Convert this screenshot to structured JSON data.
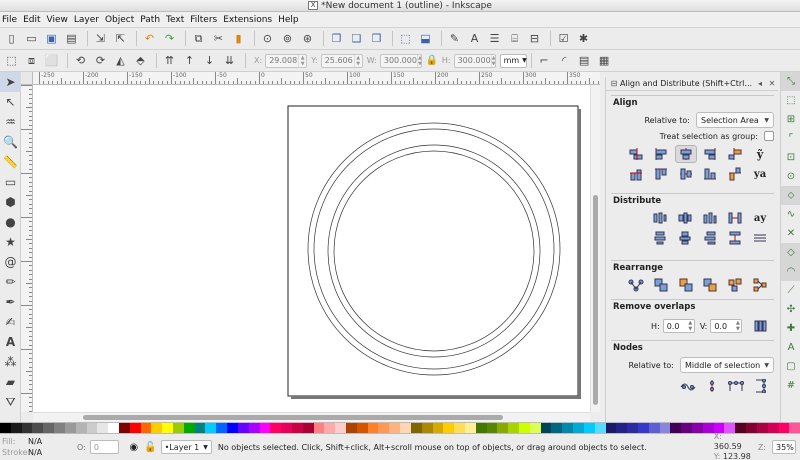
{
  "window": {
    "title": "*New document 1 (outline) - Inkscape"
  },
  "menu": [
    "File",
    "Edit",
    "View",
    "Layer",
    "Object",
    "Path",
    "Text",
    "Filters",
    "Extensions",
    "Help"
  ],
  "controls": {
    "x_label": "X:",
    "x_value": "29.008",
    "y_label": "Y:",
    "y_value": "25.606",
    "w_label": "W:",
    "w_value": "300.000",
    "h_label": "H:",
    "h_value": "300.000",
    "unit": "mm"
  },
  "ruler": {
    "labels": [
      "-250",
      "-200",
      "-150",
      "-100",
      "-50",
      "0",
      "50",
      "100",
      "150",
      "200",
      "250",
      "300",
      "350",
      "400"
    ]
  },
  "align_panel": {
    "title": "Align and Distribute (Shift+Ctrl...",
    "align": {
      "heading": "Align",
      "relative_to_label": "Relative to:",
      "relative_to_value": "Selection Area",
      "group_label": "Treat selection as group:"
    },
    "distribute_heading": "Distribute",
    "rearrange_heading": "Rearrange",
    "remove_overlaps": {
      "heading": "Remove overlaps",
      "h_label": "H:",
      "h_value": "0.0",
      "v_label": "V:",
      "v_value": "0.0"
    },
    "nodes": {
      "heading": "Nodes",
      "relative_to_label": "Relative to:",
      "relative_to_value": "Middle of selection"
    }
  },
  "status": {
    "fill_label": "Fill:",
    "fill_value": "N/A",
    "stroke_label": "Stroke:",
    "stroke_value": "N/A",
    "opacity_label": "O:",
    "opacity_value": "0",
    "layer": "•Layer 1",
    "message": "No objects selected. Click, Shift+click, Alt+scroll mouse on top of objects, or drag around objects to select.",
    "x_label": "X:",
    "x_value": "360.59",
    "y_label": "Y:",
    "y_value": "123.98",
    "z_label": "Z:",
    "zoom": "35%"
  },
  "palette": [
    "#000000",
    "#1a1a1a",
    "#333333",
    "#4d4d4d",
    "#666666",
    "#808080",
    "#999999",
    "#b3b3b3",
    "#cccccc",
    "#e6e6e6",
    "#ffffff",
    "#800000",
    "#ff0000",
    "#ff6600",
    "#ffcc00",
    "#ffff00",
    "#99cc00",
    "#00aa00",
    "#008080",
    "#00ccff",
    "#0066ff",
    "#0000ff",
    "#6600ff",
    "#aa00ff",
    "#ff00ff",
    "#ff0066",
    "#e6005c",
    "#cc0044",
    "#aa0033",
    "#ff8080",
    "#ffaaaa",
    "#ffcccc",
    "#aa4400",
    "#d45500",
    "#ff7f2a",
    "#ff9955",
    "#ffb380",
    "#ffd5b3",
    "#806600",
    "#aa8800",
    "#d4aa00",
    "#ffcc00",
    "#ffdd55",
    "#ffee99",
    "#447700",
    "#558800",
    "#88aa00",
    "#aad400",
    "#ccff00",
    "#ddff55",
    "#004455",
    "#006680",
    "#0088aa",
    "#00aad4",
    "#00ccff",
    "#55ddff",
    "#1a1a66",
    "#222288",
    "#2c2ca0",
    "#3737c8",
    "#5f5fd3",
    "#8787de",
    "#440055",
    "#660080",
    "#8800aa",
    "#aa00d4",
    "#cc00ff",
    "#dd55ff",
    "#550022",
    "#800033",
    "#aa0044",
    "#d40055",
    "#ff0066",
    "#ff5599"
  ]
}
